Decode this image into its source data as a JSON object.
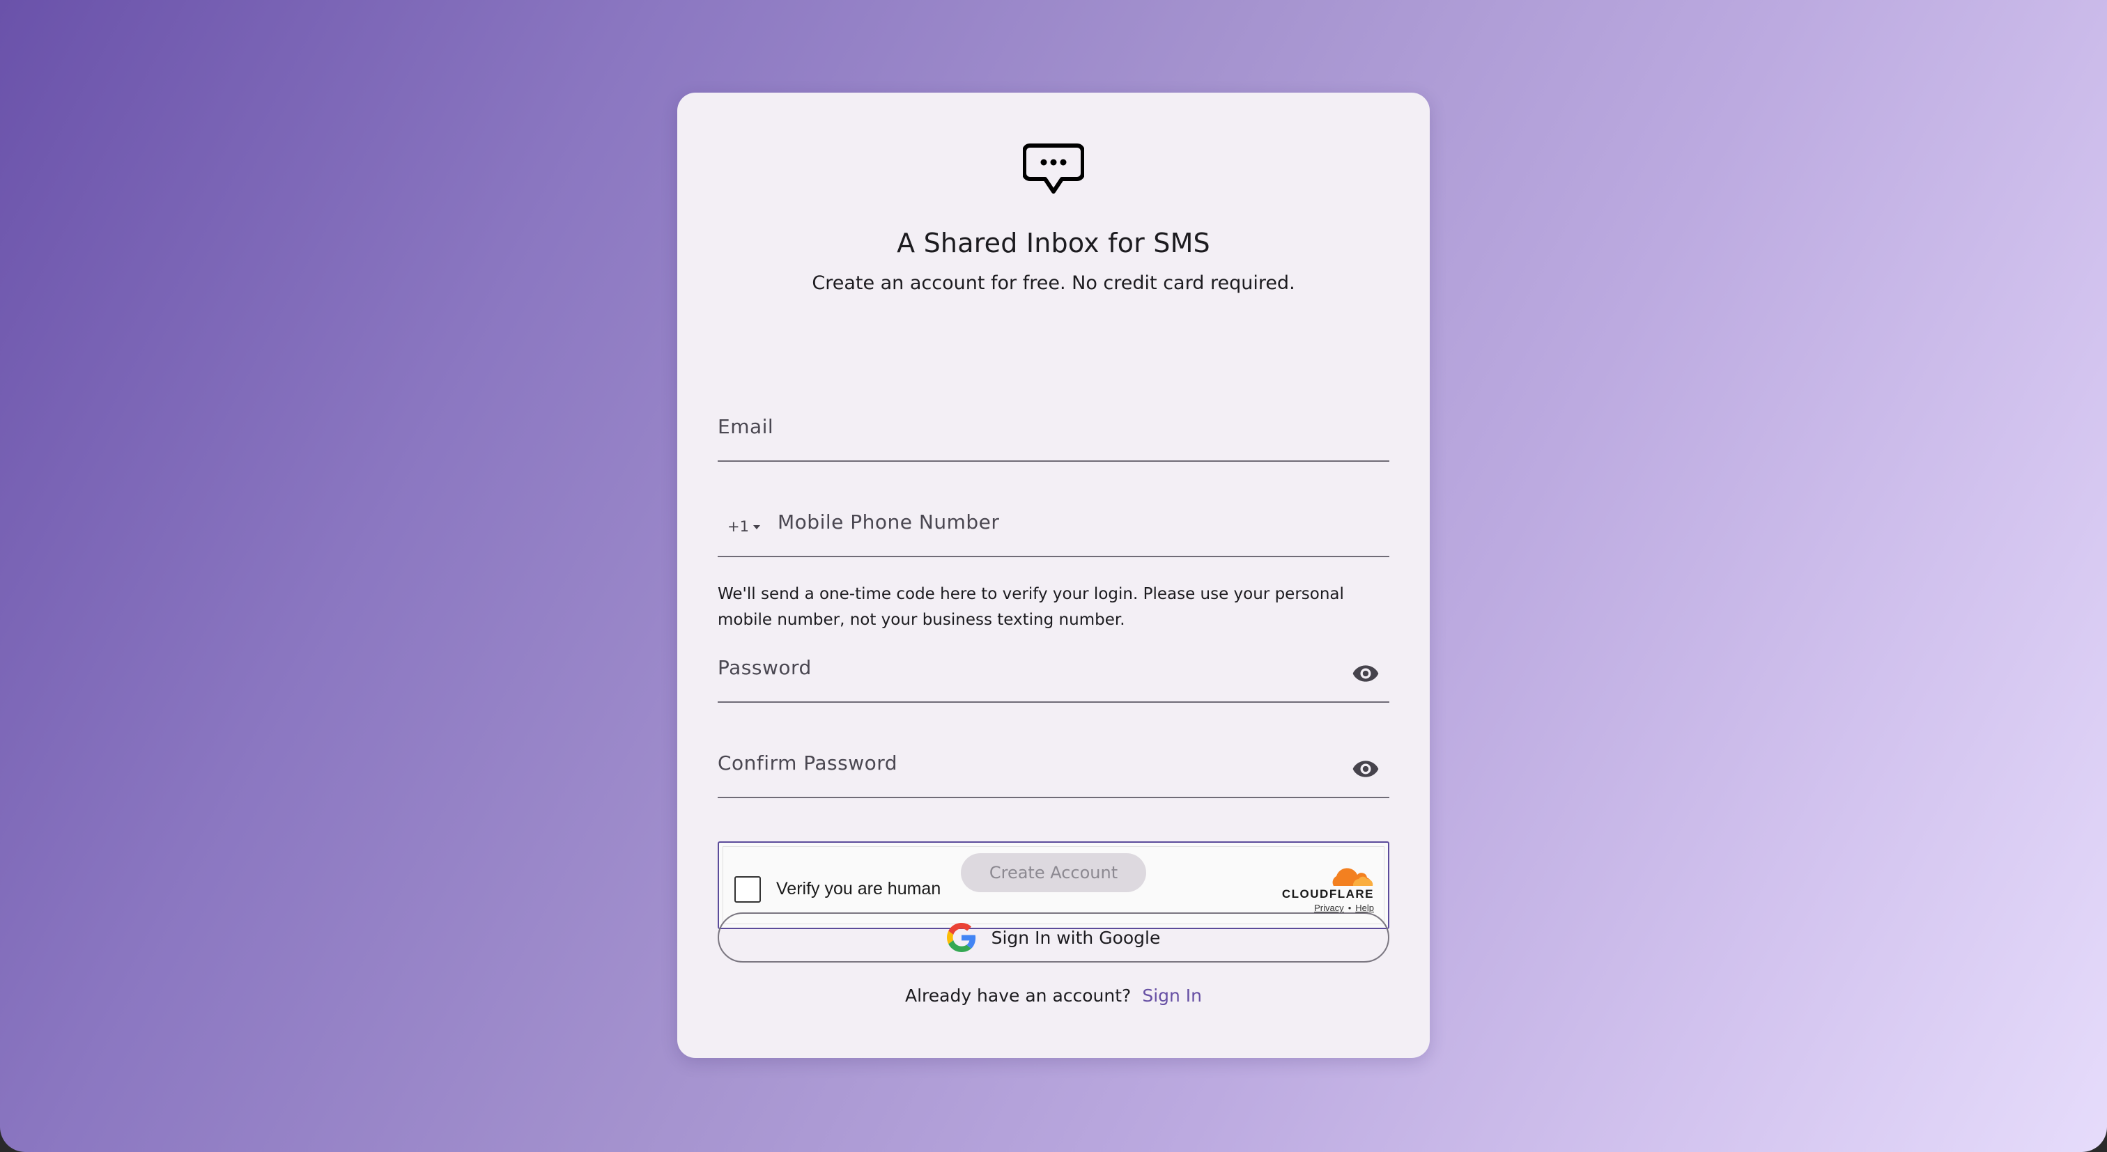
{
  "header": {
    "logo_icon": "chat-bubble-ellipsis-icon",
    "title": "A Shared Inbox for SMS",
    "subtitle": "Create an account for free. No credit card required."
  },
  "form": {
    "email_placeholder": "Email",
    "country_code": "+1",
    "phone_placeholder": "Mobile Phone Number",
    "phone_helper": "We'll send a one-time code here to verify your login. Please use your personal mobile number, not your business texting number.",
    "password_placeholder": "Password",
    "confirm_password_placeholder": "Confirm Password",
    "visibility_icon": "eye-icon"
  },
  "captcha": {
    "label": "Verify you are human",
    "brand": "CLOUDFLARE",
    "privacy_link": "Privacy",
    "separator": "•",
    "help_link": "Help",
    "brand_color": "#f38020"
  },
  "actions": {
    "create_account_label": "Create Account",
    "google_label": "Sign In with Google",
    "already_text": "Already have an account?",
    "sign_in_link": "Sign In"
  },
  "colors": {
    "primary": "#6750a4",
    "card_background": "#f3eff5",
    "gradient_start": "#6a52aa",
    "gradient_end": "#e6dcfb"
  }
}
